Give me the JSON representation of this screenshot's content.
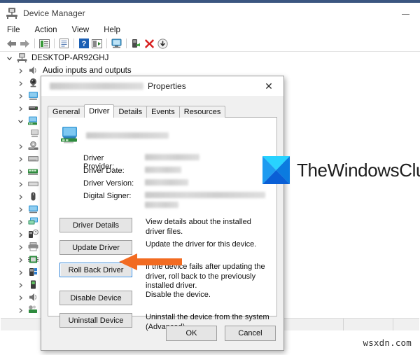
{
  "window": {
    "title": "Device Manager",
    "title_icon": "device-manager-icon",
    "minimize_label": "Minimize",
    "menu": [
      "File",
      "Action",
      "View",
      "Help"
    ],
    "toolbar": [
      {
        "name": "back-icon",
        "type": "arrow-left"
      },
      {
        "name": "forward-icon",
        "type": "arrow-right"
      },
      {
        "name": "separator",
        "type": "sep"
      },
      {
        "name": "properties-icon",
        "type": "properties"
      },
      {
        "name": "separator",
        "type": "sep"
      },
      {
        "name": "update-driver-icon",
        "type": "document"
      },
      {
        "name": "separator",
        "type": "sep"
      },
      {
        "name": "help-icon",
        "type": "help"
      },
      {
        "name": "show-hidden-devices-icon",
        "type": "scan"
      },
      {
        "name": "separator",
        "type": "sep"
      },
      {
        "name": "scan-hardware-icon",
        "type": "monitor"
      },
      {
        "name": "separator",
        "type": "sep"
      },
      {
        "name": "enable-device-icon",
        "type": "enable"
      },
      {
        "name": "uninstall-device-icon",
        "type": "close-x"
      },
      {
        "name": "scan-changes-icon",
        "type": "download"
      }
    ],
    "status_bar": ""
  },
  "tree": {
    "root": {
      "label": "DESKTOP-AR92GHJ",
      "expanded": true,
      "icon": "computer-icon"
    },
    "items": [
      {
        "label": "Audio inputs and outputs",
        "expanded": false,
        "icon": "speaker-icon"
      },
      {
        "label": "",
        "expanded": false,
        "icon": "camera-icon"
      },
      {
        "label": "",
        "expanded": false,
        "icon": "monitor-icon"
      },
      {
        "label": "",
        "expanded": false,
        "icon": "disk-icon"
      },
      {
        "label": "",
        "expanded": true,
        "icon": "display-adapter-icon"
      },
      {
        "label": "",
        "expanded": false,
        "icon": "display-child-icon"
      },
      {
        "label": "",
        "expanded": false,
        "icon": "dvd-icon"
      },
      {
        "label": "",
        "expanded": false,
        "icon": "keyboard-icon"
      },
      {
        "label": "",
        "expanded": false,
        "icon": "network-icon"
      },
      {
        "label": "",
        "expanded": false,
        "icon": "keyboard2-icon"
      },
      {
        "label": "",
        "expanded": false,
        "icon": "mouse-icon"
      },
      {
        "label": "",
        "expanded": false,
        "icon": "monitor2-icon"
      },
      {
        "label": "",
        "expanded": false,
        "icon": "monitor3-icon"
      },
      {
        "label": "",
        "expanded": false,
        "icon": "network2-icon"
      },
      {
        "label": "",
        "expanded": false,
        "icon": "unknown-device-icon"
      },
      {
        "label": "",
        "expanded": false,
        "icon": "printer-icon"
      },
      {
        "label": "",
        "expanded": false,
        "icon": "processor-icon"
      },
      {
        "label": "",
        "expanded": false,
        "icon": "security-device-icon"
      },
      {
        "label": "",
        "expanded": false,
        "icon": "software-device-icon"
      },
      {
        "label": "",
        "expanded": false,
        "icon": "sound-icon"
      },
      {
        "label": "",
        "expanded": false,
        "icon": "system-devices-icon"
      },
      {
        "label": "",
        "expanded": false,
        "icon": "display-adapter2-icon"
      },
      {
        "label": "",
        "expanded": false,
        "icon": "usb-icon"
      }
    ]
  },
  "dialog": {
    "title_redacted": true,
    "title_suffix": "Properties",
    "close_label": "✕",
    "tabs": [
      {
        "label": "General",
        "active": false
      },
      {
        "label": "Driver",
        "active": true
      },
      {
        "label": "Details",
        "active": false
      },
      {
        "label": "Events",
        "active": false
      },
      {
        "label": "Resources",
        "active": false
      }
    ],
    "device_name_redacted": true,
    "device_icon": "display-adapter-icon",
    "info_rows": [
      {
        "label": "Driver Provider:",
        "value_redacted": true,
        "lines": 1
      },
      {
        "label": "Driver Date:",
        "value_redacted": true,
        "lines": 1
      },
      {
        "label": "Driver Version:",
        "value_redacted": true,
        "lines": 1
      },
      {
        "label": "Digital Signer:",
        "value_redacted": true,
        "lines": 2
      }
    ],
    "actions": [
      {
        "button": "Driver Details",
        "desc": "View details about the installed driver files.",
        "focused": false
      },
      {
        "button": "Update Driver",
        "desc": "Update the driver for this device.",
        "focused": false
      },
      {
        "button": "Roll Back Driver",
        "desc": "If the device fails after updating the driver, roll back to the previously installed driver.",
        "focused": true
      },
      {
        "button": "Disable Device",
        "desc": "Disable the device.",
        "focused": false
      },
      {
        "button": "Uninstall Device",
        "desc": "Uninstall the device from the system (Advanced).",
        "focused": false
      }
    ],
    "ok_label": "OK",
    "cancel_label": "Cancel"
  },
  "annotation": {
    "arrow_color": "#F26B21",
    "arrow_target": "Roll Back Driver"
  },
  "branding": {
    "logo_name": "thewindowsclub-logo",
    "text": "TheWindowsClub",
    "colors": {
      "top": "#28D2FF",
      "left": "#1E9BF0",
      "right": "#0B7BE0",
      "bottom": "#0A5FD6"
    }
  },
  "watermark": "wsxdn.com"
}
